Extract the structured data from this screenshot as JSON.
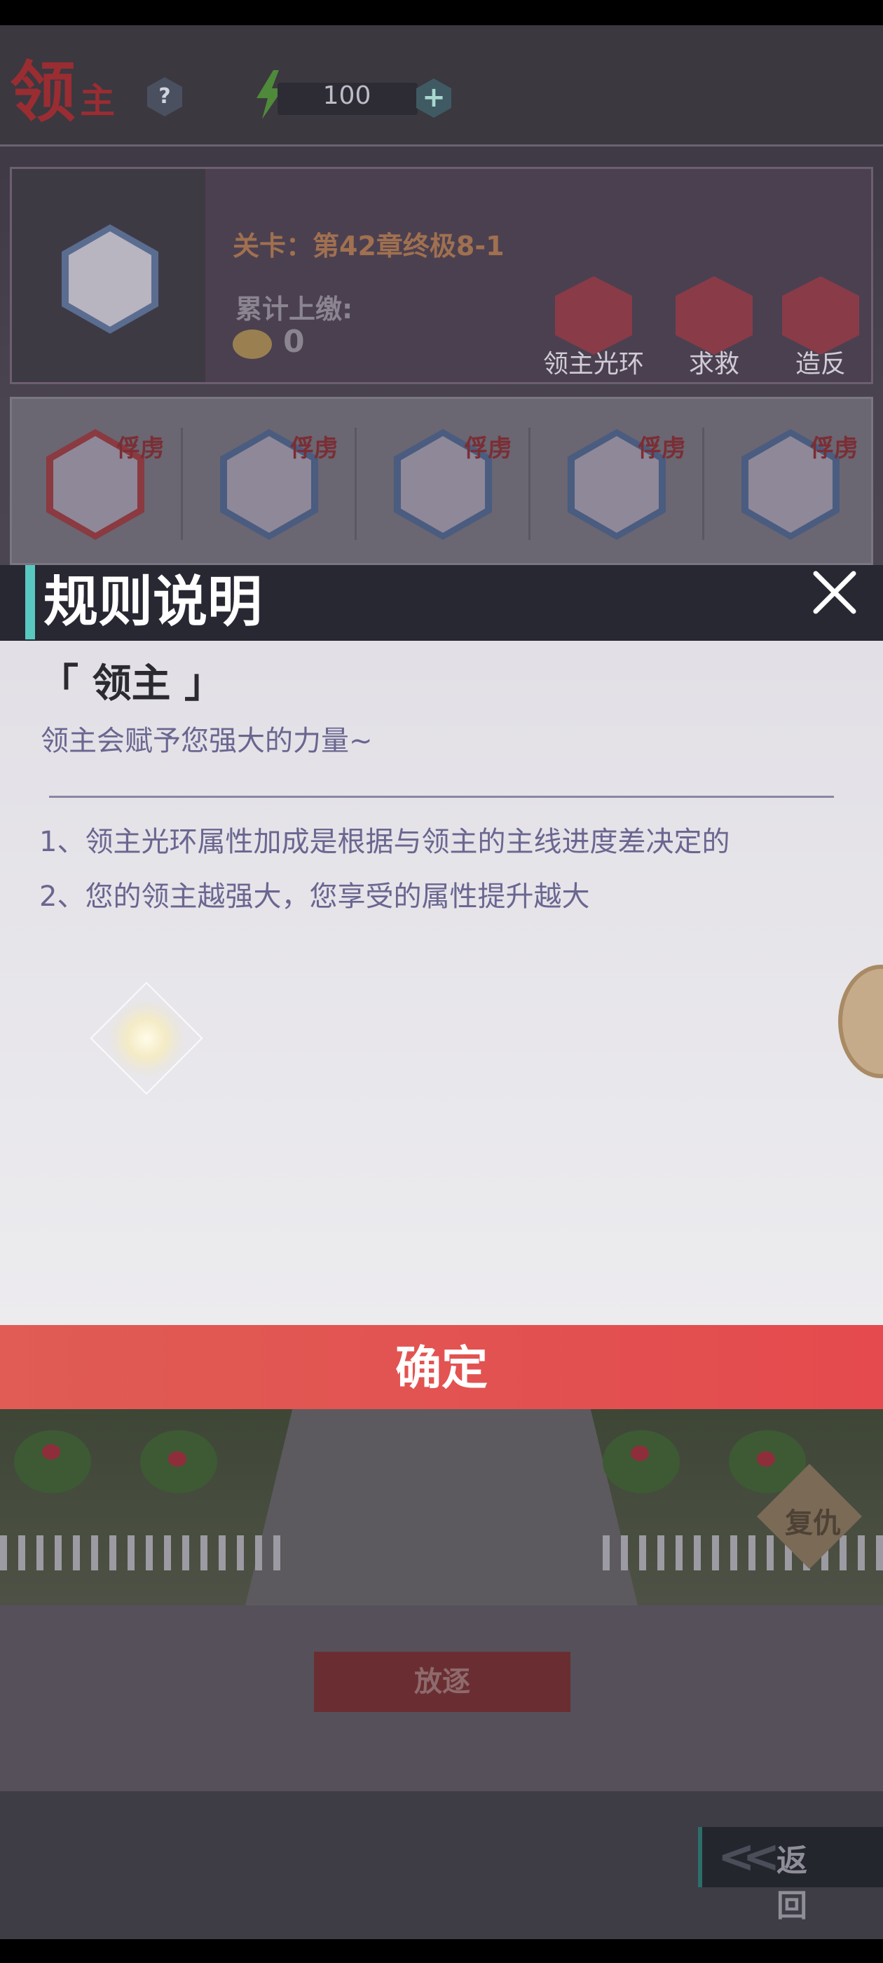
{
  "screen": {
    "title_big": "领",
    "title_small": "主",
    "help_icon_text": "?",
    "energy_value": "100",
    "plus_icon_text": "+"
  },
  "lord_info": {
    "stage": "关卡：第42章终极8-1",
    "tribute_label": "累计上缴:",
    "tribute_value": "0",
    "actions": [
      {
        "label": "领主光环",
        "icon": "aura-icon"
      },
      {
        "label": "求救",
        "icon": "rescue-icon"
      },
      {
        "label": "造反",
        "icon": "rebel-icon"
      }
    ]
  },
  "roster": {
    "captive_tag": "俘虏",
    "count": 5
  },
  "dialog": {
    "title": "规则说明",
    "heading": "「 领主 」",
    "subtitle": "领主会赋予您强大的力量~",
    "rules": [
      "1、领主光环属性加成是根据与领主的主线进度差决定的",
      "2、您的领主越强大，您享受的属性提升越大"
    ],
    "confirm_label": "确定",
    "accent_color": "#58c8c0",
    "confirm_color": "#e44a4e"
  },
  "background_buttons": {
    "revenge": "复仇",
    "exile": "放逐",
    "back": "返 回"
  }
}
